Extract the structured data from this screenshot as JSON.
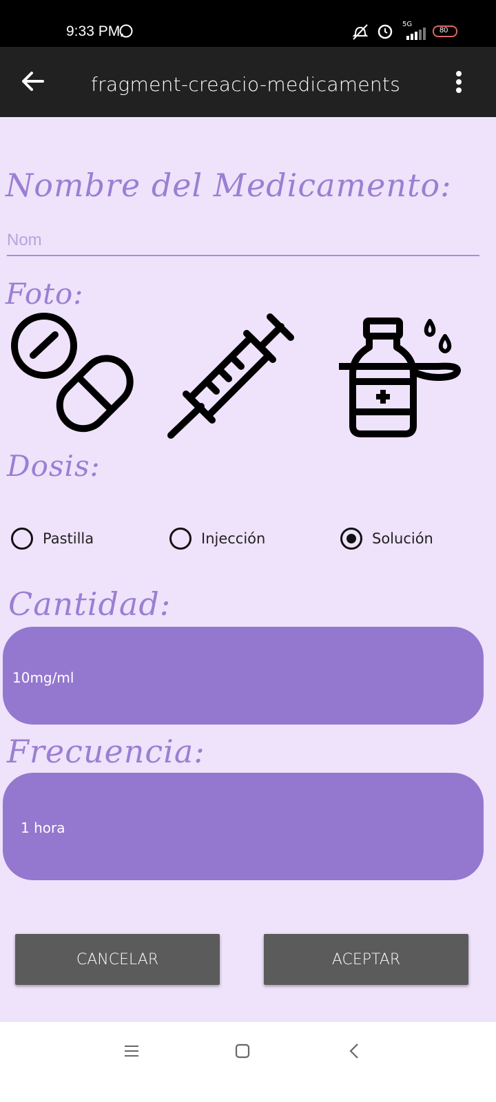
{
  "status_bar": {
    "time": "9:33 PM",
    "network": "5G",
    "battery": "80"
  },
  "app_bar": {
    "title": "fragment-creacio-medicaments"
  },
  "form": {
    "name_heading": "Nombre del Medicamento:",
    "name_placeholder": "Nom",
    "photo_heading": "Foto:",
    "photo_options": [
      "pill-icon",
      "syringe-icon",
      "bottle-spoon-icon"
    ],
    "dose_heading": "Dosis:",
    "dose_options": [
      {
        "label": "Pastilla",
        "selected": false
      },
      {
        "label": "Injección",
        "selected": false
      },
      {
        "label": "Solución",
        "selected": true
      }
    ],
    "quantity_heading": "Cantidad:",
    "quantity_value": "10mg/ml",
    "frequency_heading": "Frecuencia:",
    "frequency_value": "1 hora"
  },
  "buttons": {
    "cancel": "CANCELAR",
    "accept": "ACEPTAR"
  },
  "colors": {
    "background": "#efe2fb",
    "accent": "#9477ce",
    "heading": "#9a7fd2",
    "button": "#5b5b5b",
    "app_bar": "#212121"
  }
}
